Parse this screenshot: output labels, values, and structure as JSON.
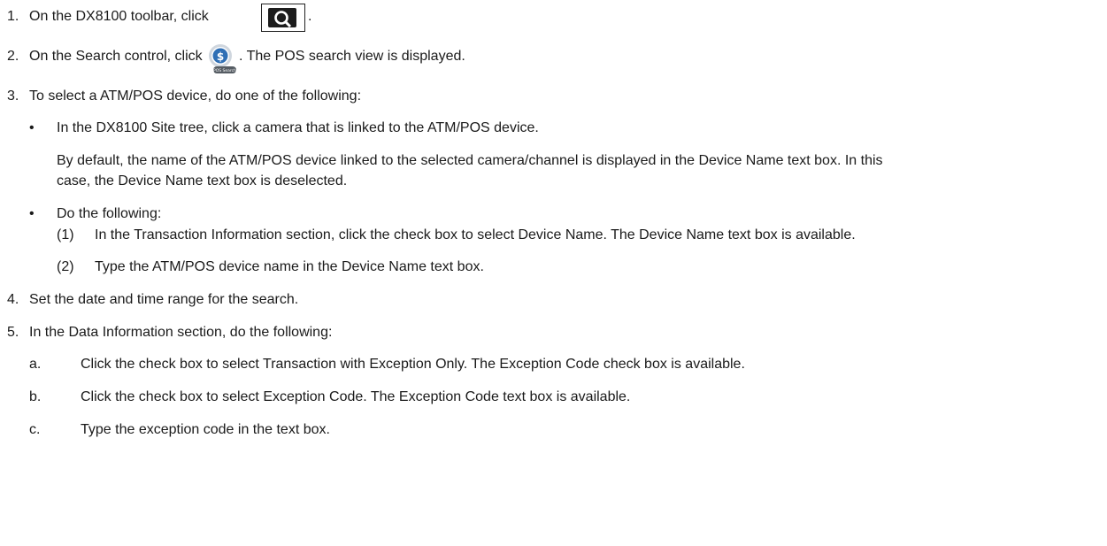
{
  "steps": [
    {
      "num": "1.",
      "before": "On the DX8100 toolbar, click",
      "after": "."
    },
    {
      "num": "2.",
      "before": "On the Search control, click",
      "after": ". The POS search view is displayed.",
      "icon_caption": "POS Search"
    },
    {
      "num": "3.",
      "text": "To select a ATM/POS device, do one of the following:"
    },
    {
      "bullet": "•",
      "text": "In the DX8100 Site tree, click a camera that is linked to the ATM/POS device."
    },
    {
      "text": "By default, the name of the ATM/POS device linked to the selected camera/channel is displayed in the Device Name text box. In this"
    },
    {
      "text": "case, the Device Name text box is deselected."
    },
    {
      "bullet": "•",
      "text": "Do the following:"
    },
    {
      "num": "(1)",
      "text": "In the Transaction Information section, click the check box to select Device Name. The Device Name text box is available."
    },
    {
      "num": "(2)",
      "text": "Type the ATM/POS device name in the Device Name text box."
    },
    {
      "num": "4.",
      "text": "Set the date and time range for the search."
    },
    {
      "num": "5.",
      "text": "In the Data Information section, do the following:"
    },
    {
      "num": "a.",
      "text": "Click the check box to select Transaction with Exception Only. The Exception Code check box is available."
    },
    {
      "num": "b.",
      "text": "Click the check box to select Exception Code. The Exception Code text box is available."
    },
    {
      "num": "c.",
      "text": "Type the exception code in the text box."
    }
  ],
  "icons": {
    "toolbar_search": "search-toolbar-icon",
    "pos_search": "pos-search-icon",
    "accent": "#2f6fb5"
  }
}
